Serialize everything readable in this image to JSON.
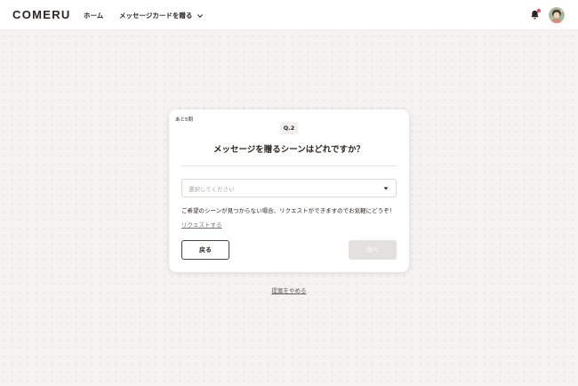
{
  "header": {
    "logo": "COMERU",
    "nav": {
      "home": "ホーム",
      "send_card": "メッセージカードを贈る"
    },
    "icons": {
      "notification": "bell-icon",
      "dropdown": "chevron-down-icon",
      "avatar": "user-avatar"
    },
    "notification_dot_color": "#e34b4b"
  },
  "card": {
    "remaining": "あと5問",
    "question_number": "Q.2",
    "question_title": "メッセージを贈るシーンはどれですか？",
    "select": {
      "placeholder": "選択してください",
      "icon": "caret-down-icon"
    },
    "hint": "ご希望のシーンが見つからない場合、リクエストができますのでお気軽にどうぞ！",
    "request_link": "リクエストする",
    "back_button": "戻る",
    "next_button": "次へ"
  },
  "footer": {
    "quit_link": "提案をやめる"
  },
  "colors": {
    "background": "#f4f3f1",
    "text": "#2b2622",
    "disabled_button": "#e3e1dd"
  }
}
